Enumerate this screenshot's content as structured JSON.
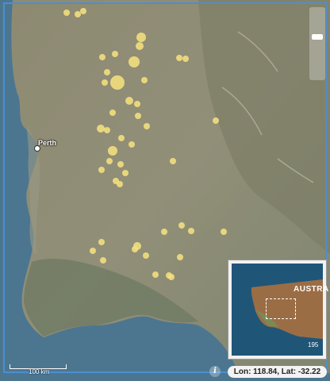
{
  "map": {
    "city": "Perth",
    "scale_label": "100 km",
    "overview": {
      "label": "AUSTRA",
      "number": "195"
    },
    "coordinates": "Lon: 118.84, Lat: -32.22",
    "info_symbol": "i",
    "marker_color": "#f4e07e",
    "frame_color": "#4a8fd0",
    "sea_color": "#49748f",
    "land_color": "#8c8d74",
    "icons": [
      "info-icon",
      "zoom-slider"
    ]
  }
}
